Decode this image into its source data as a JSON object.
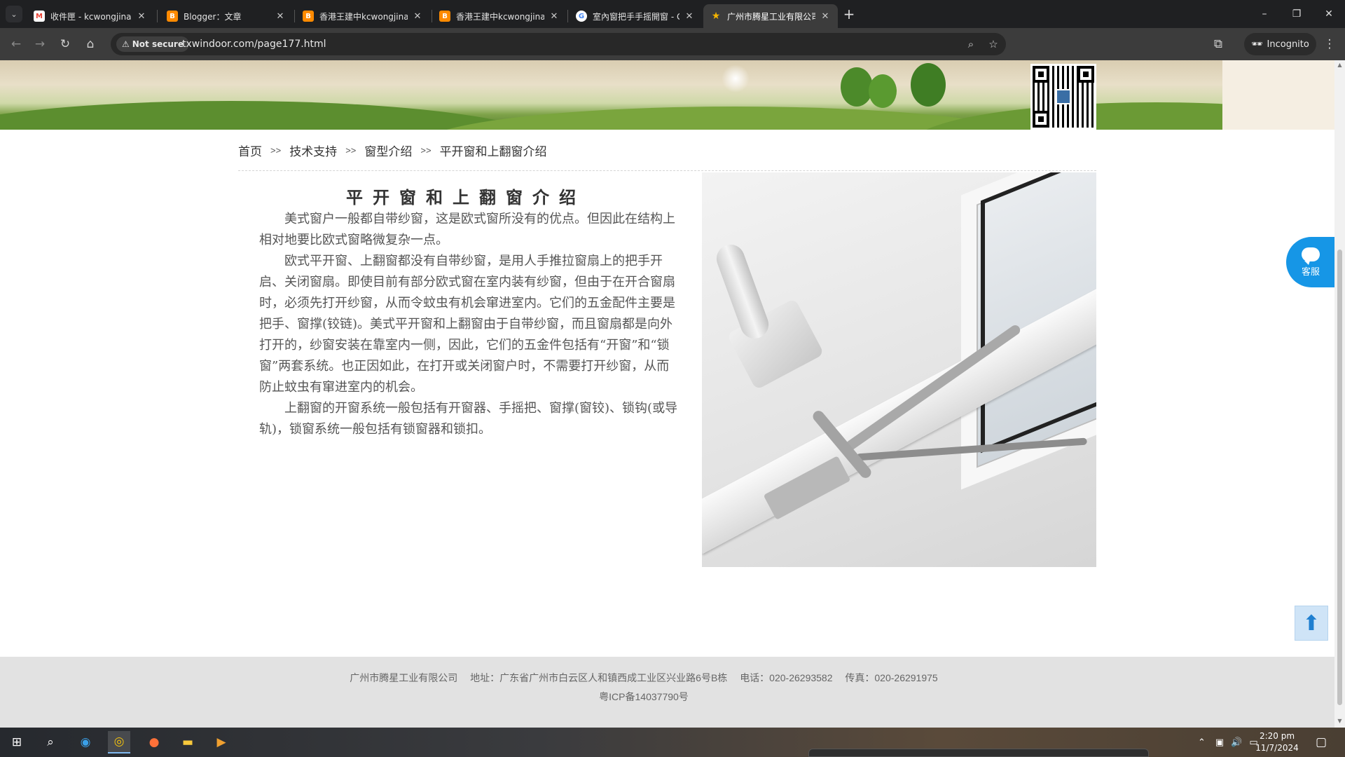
{
  "browser": {
    "tabs": [
      {
        "title": "收件匣 - kcwongjinan@gmail.c",
        "favicon": "gmail-icon",
        "favicon_text": "M",
        "favicon_color": "#ea4335"
      },
      {
        "title": "Blogger：文章",
        "favicon": "blogger-icon",
        "favicon_text": "B",
        "favicon_color": "#ff8a00"
      },
      {
        "title": "香港王建中kcwongjinan@gmail",
        "favicon": "blogger-icon",
        "favicon_text": "B",
        "favicon_color": "#ff8a00"
      },
      {
        "title": "香港王建中kcwongjinan@gmail",
        "favicon": "blogger-icon",
        "favicon_text": "B",
        "favicon_color": "#ff8a00"
      },
      {
        "title": "室內窗把手手摇開窗 - Google 搜",
        "favicon": "google-icon",
        "favicon_text": "G",
        "favicon_color": "#4285f4"
      },
      {
        "title": "广州市腾星工业有限公司",
        "favicon": "star-icon",
        "favicon_text": "★",
        "favicon_color": "#f4b400"
      }
    ],
    "security_label": "Not secure",
    "url": "txwindoor.com/page177.html",
    "incognito_label": "Incognito"
  },
  "page": {
    "breadcrumb": [
      "首页",
      "技术支持",
      "窗型介绍",
      "平开窗和上翻窗介绍"
    ],
    "breadcrumb_separator": ">>",
    "article": {
      "title": "平开窗和上翻窗介绍",
      "paragraphs": [
        "美式窗户一般都自带纱窗，这是欧式窗所没有的优点。但因此在结构上相对地要比欧式窗略微复杂一点。",
        "欧式平开窗、上翻窗都没有自带纱窗，是用人手推拉窗扇上的把手开启、关闭窗扇。即使目前有部分欧式窗在室内装有纱窗，但由于在开合窗扇时，必须先打开纱窗，从而令蚊虫有机会窜进室内。它们的五金配件主要是把手、窗撑(铰链)。美式平开窗和上翻窗由于自带纱窗，而且窗扇都是向外打开的，纱窗安装在靠室内一侧，因此，它们的五金件包括有“开窗”和“锁窗”两套系统。也正因如此，在打开或关闭窗户时，不需要打开纱窗，从而防止蚊虫有窜进室内的机会。",
        "上翻窗的开窗系统一般包括有开窗器、手摇把、窗撑(窗铰)、锁钩(或导轨)，锁窗系统一般包括有锁窗器和锁扣。"
      ]
    },
    "customer_service_label": "客服",
    "footer": {
      "company": "广州市腾星工业有限公司",
      "address": "地址：广东省广州市白云区人和镇西成工业区兴业路6号B栋",
      "phone": "电话：020-26293582",
      "fax": "传真：020-26291975",
      "icp": "粤ICP备14037790号"
    }
  },
  "taskbar": {
    "time": "2:20 pm",
    "date": "11/7/2024"
  },
  "colors": {
    "accent_blue": "#1696e6",
    "footer_bg": "#e2e2e2",
    "chrome_dark": "#1f2022"
  }
}
